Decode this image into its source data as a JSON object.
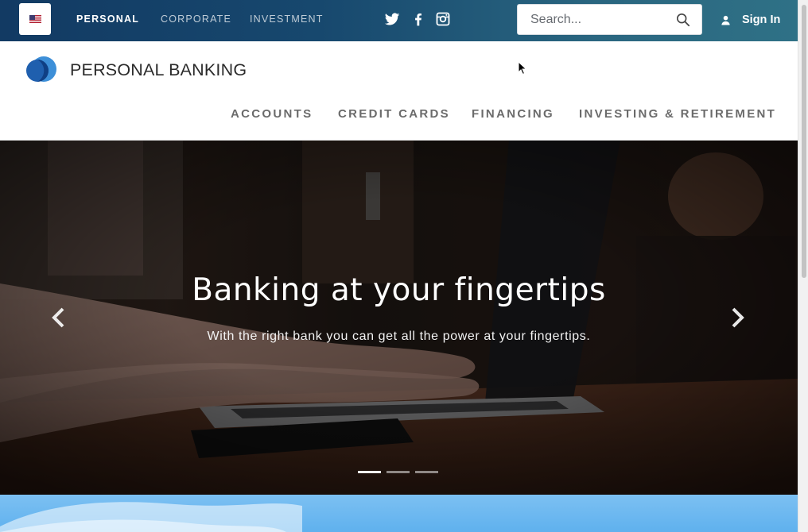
{
  "topbar": {
    "flag_icon": "us-flag-icon",
    "segments": [
      {
        "label": "PERSONAL",
        "active": true
      },
      {
        "label": "CORPORATE",
        "active": false
      },
      {
        "label": "INVESTMENT",
        "active": false
      }
    ],
    "social_icons": [
      "twitter-icon",
      "facebook-icon",
      "instagram-icon"
    ],
    "search": {
      "placeholder": "Search...",
      "value": ""
    },
    "signin_label": "Sign In"
  },
  "brand": {
    "name": "PERSONAL BANKING",
    "logo_colors": [
      "#1f5fae",
      "#3d8fd8"
    ]
  },
  "main_nav": [
    {
      "label": "ACCOUNTS"
    },
    {
      "label": "CREDIT CARDS"
    },
    {
      "label": "FINANCING"
    },
    {
      "label": "INVESTING & RETIREMENT"
    }
  ],
  "hero": {
    "slide_count": 3,
    "active_slide": 1,
    "slides": [
      {
        "title": "Banking at your fingertips",
        "subtitle": "With the right bank you can get all the power at your fingertips."
      }
    ],
    "prev_icon": "chevron-left-icon",
    "next_icon": "chevron-right-icon"
  },
  "colors": {
    "topbar_start": "#123a63",
    "topbar_end": "#2f7186",
    "nav_text": "#6b6b6b",
    "sky": "#5fb1ee"
  }
}
